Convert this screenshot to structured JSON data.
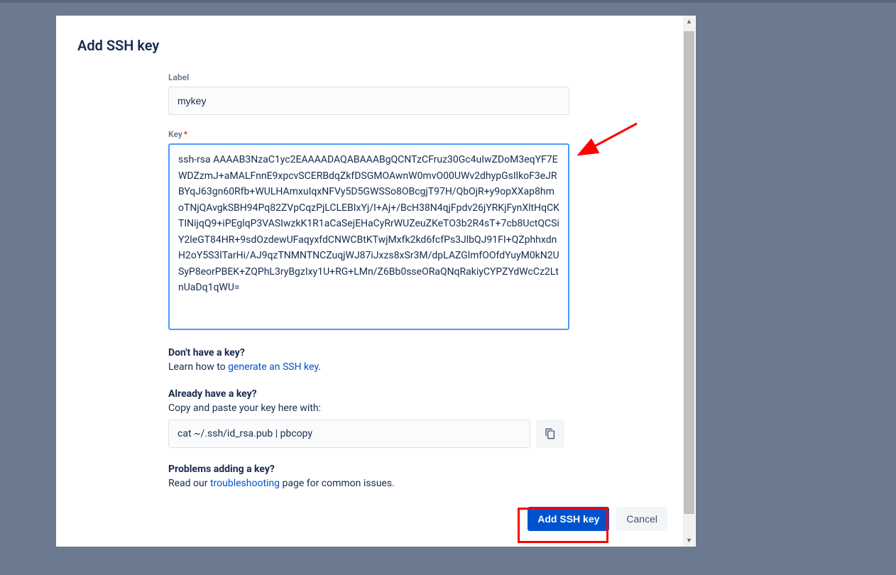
{
  "modal": {
    "title": "Add SSH key",
    "labelField": {
      "label": "Label",
      "value": "mykey"
    },
    "keyField": {
      "label": "Key",
      "required": "*",
      "value": "ssh-rsa AAAAB3NzaC1yc2EAAAADAQABAAABgQCNTzCFruz30Gc4uIwZDoM3eqYF7EWDZzmJ+aMALFnnE9xpcvSCERBdqZkfDSGMOAwnW0mvO00UWv2dhypGsIlkoF3eJRBYqJ63gn60Rfb+WULHAmxuIqxNFVy5D5GWSSo8OBcgjT97H/QbOjR+y9opXXap8hmoTNjQAvgkSBH94Pq82ZVpCqzPjLCLEBIxYj/I+Aj+/BcH38N4qjFpdv26jYRKjFynXltHqCKTINijqQ9+iPEglqP3VASIwzkK1R1aCaSejEHaCyRrWUZeuZKeTO3b2R4sT+7cb8UctQCSiY2leGT84HR+9sdOzdewUFaqyxfdCNWCBtKTwjMxfk2kd6fcfPs3JlbQJ91FI+QZphhxdnH2oY5S3lTarHi/AJ9qzTNMNTNCZuqjWJ87iJxzs8xSr3M/dpLAZGlmfOOfdYuyM0kN2USyP8eorPBEK+ZQPhL3ryBgzIxy1U+RG+LMn/Z6Bb0sseORaQNqRakiyCYPZYdWcCz2LtnUaDq1qWU="
    },
    "help1": {
      "heading": "Don't have a key?",
      "textBefore": "Learn how to ",
      "linkText": "generate an SSH key",
      "textAfter": "."
    },
    "help2": {
      "heading": "Already have a key?",
      "text": "Copy and paste your key here with:",
      "command": "cat ~/.ssh/id_rsa.pub | pbcopy"
    },
    "help3": {
      "heading": "Problems adding a key?",
      "textBefore": "Read our ",
      "linkText": "troubleshooting",
      "textAfter": " page for common issues."
    },
    "actions": {
      "primary": "Add SSH key",
      "cancel": "Cancel"
    }
  }
}
